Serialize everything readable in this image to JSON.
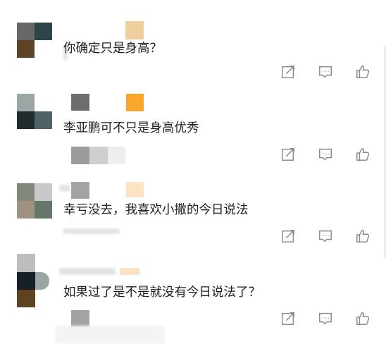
{
  "comments": [
    {
      "text": "你确定只是身高？"
    },
    {
      "text": "李亚鹏可不只是身高优秀"
    },
    {
      "text": "幸亏没去，我喜欢小撒的今日说法"
    },
    {
      "text": "如果过了是不是就没有今日说法了？"
    }
  ],
  "actions": {
    "icons": [
      "share-icon",
      "comment-icon",
      "like-icon"
    ]
  },
  "colors": {
    "icon_stroke": "#8a8a8a",
    "text": "#1e1e1e"
  }
}
